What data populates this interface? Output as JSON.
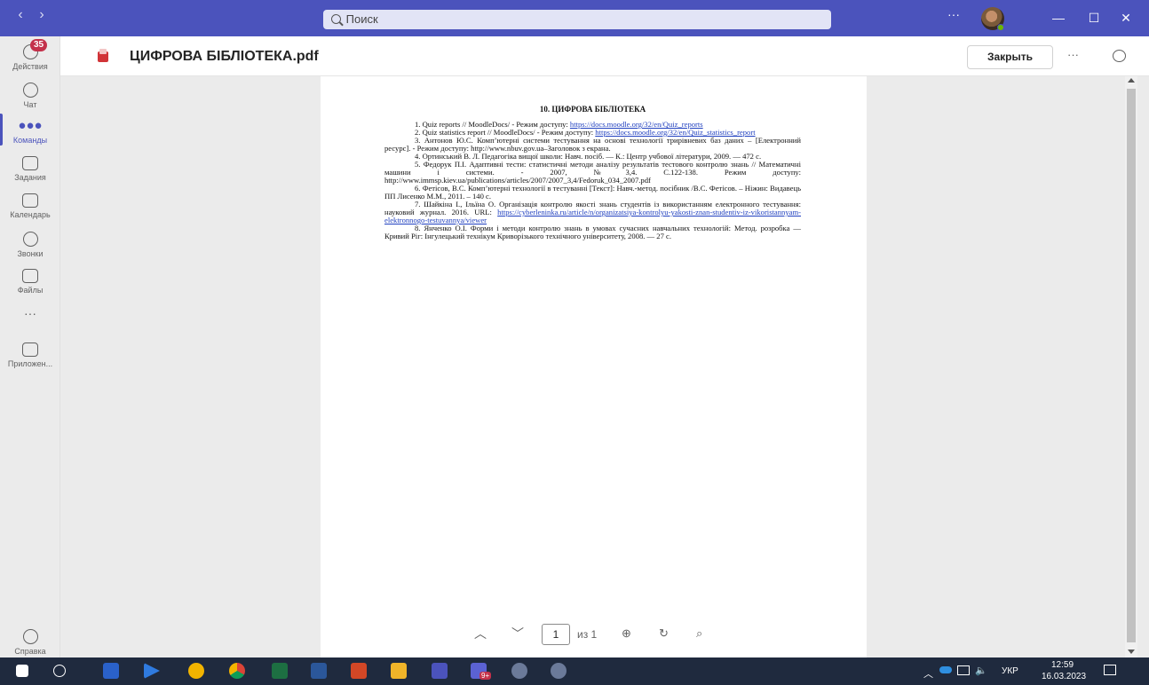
{
  "titlebar": {
    "search_placeholder": "Поиск",
    "more": "···"
  },
  "rail": {
    "badge_count": "35",
    "items": [
      {
        "label": "Действия",
        "icon": "bell-icon"
      },
      {
        "label": "Чат",
        "icon": "chat-icon"
      },
      {
        "label": "Команды",
        "icon": "teams-icon",
        "active": true
      },
      {
        "label": "Задания",
        "icon": "assignments-icon"
      },
      {
        "label": "Календарь",
        "icon": "calendar-icon"
      },
      {
        "label": "Звонки",
        "icon": "phone-icon"
      },
      {
        "label": "Файлы",
        "icon": "file-icon"
      },
      {
        "label": "Приложен...",
        "icon": "apps-icon"
      },
      {
        "label": "Справка",
        "icon": "help-icon"
      }
    ],
    "more": "···"
  },
  "header": {
    "title": "ЦИФРОВА БІБЛІОТЕКА.pdf",
    "close_label": "Закрыть",
    "more": "···"
  },
  "document": {
    "heading": "10. ЦИФРОВА БІБЛІОТЕКА",
    "refs": [
      {
        "text": "1. Quiz reports // MoodleDocs/ - Режим доступу:",
        "link": "https://docs.moodle.org/32/en/Quiz_reports"
      },
      {
        "text": "2. Quiz statistics report // MoodleDocs/ - Режим доступу:",
        "link": "https://docs.moodle.org/32/en/Quiz_statistics_report"
      },
      {
        "text": "3. Антонов Ю.С. Комп’ютерні системи тестування на основі технології трирівневих баз даних – [Електронний ресурс]. - Режим доступу: http://www.nbuv.gov.ua–Заголовок з екрана.",
        "link": ""
      },
      {
        "text": "4. Ортинський В. Л. Педагогіка вищої школи: Навч. посіб. — К.: Центр учбової літератури, 2009. — 472 с.",
        "link": ""
      },
      {
        "text": "5. Федорук П.І. Адаптивні тести: статистичні методи аналізу результатів тестового контролю знань // Математичні машини і системи. - 2007, №3,4. С.122-138. Режим доступу: http://www.immsp.kiev.ua/publications/articles/2007/2007_3,4/Fedoruk_034_2007.pdf",
        "link": ""
      },
      {
        "text": "6. Фетісов, В.С. Комп’ютерні технології в тестуванні [Текст]: Навч.-метод. посібник /В.С. Фетісов. – Ніжин: Видавець ПП Лисенко М.М., 2011. – 140 с.",
        "link": ""
      },
      {
        "text": "7. Шайкіна І., Ільїна О. Організація контролю якості знань студентів із використанням електронного тестування: науковий журнал. 2016. URL:",
        "link": "https://cyberleninka.ru/article/n/organizatsiya-kontrolyu-yakosti-znan-studentiv-iz-vikoristannyam-elektronnogo-testuvannya/viewer"
      },
      {
        "text": "8. Янченко О.І. Форми і методи контролю знань в умовах сучасних навчальних технологій: Метод. розробка — Кривий Ріг: Інгулецький технікум Криворізького технічного університету, 2008. — 27 с.",
        "link": ""
      }
    ]
  },
  "pager": {
    "current_page": "1",
    "of_label": "из 1"
  },
  "taskbar": {
    "teams_badge": "9+",
    "language": "УКР",
    "time": "12:59",
    "date": "16.03.2023"
  },
  "colors": {
    "accent": "#4b53bc",
    "badge": "#c4314b",
    "taskbar": "#1f2a3e",
    "link": "#1f3fbf"
  }
}
